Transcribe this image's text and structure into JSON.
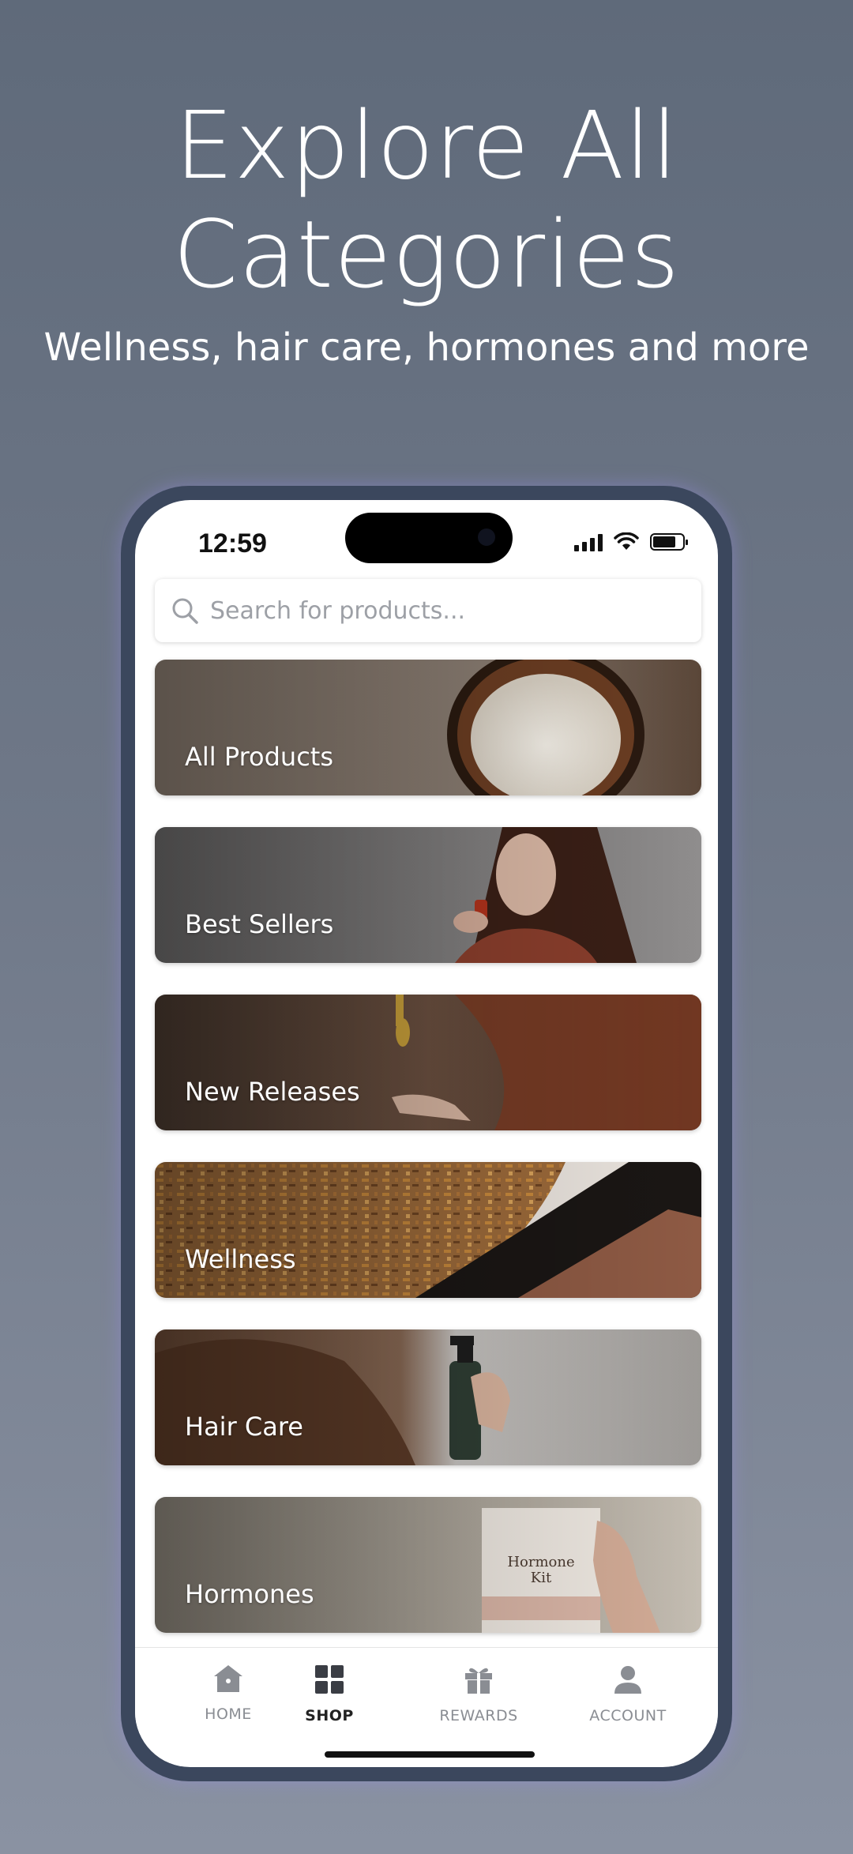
{
  "promo": {
    "headline_line1": "Explore All",
    "headline_line2": "Categories",
    "subheadline": "Wellness, hair care, hormones and more"
  },
  "status_bar": {
    "time": "12:59",
    "icons": [
      "signal-icon",
      "wifi-icon",
      "battery-icon"
    ]
  },
  "search": {
    "placeholder": "Search for products...",
    "value": ""
  },
  "categories": [
    {
      "label": "All Products"
    },
    {
      "label": "Best Sellers"
    },
    {
      "label": "New Releases"
    },
    {
      "label": "Wellness"
    },
    {
      "label": "Hair Care"
    },
    {
      "label": "Hormones"
    }
  ],
  "tabs": [
    {
      "label": "HOME",
      "icon": "home-icon",
      "active": false
    },
    {
      "label": "SHOP",
      "icon": "shop-grid-icon",
      "active": true
    },
    {
      "label": "REWARDS",
      "icon": "gift-icon",
      "active": false
    },
    {
      "label": "ACCOUNT",
      "icon": "person-icon",
      "active": false
    }
  ],
  "colors": {
    "background": "#6a7484",
    "phone_frame": "#3b475d",
    "tab_inactive": "#8a8d93",
    "tab_active": "#222222"
  }
}
